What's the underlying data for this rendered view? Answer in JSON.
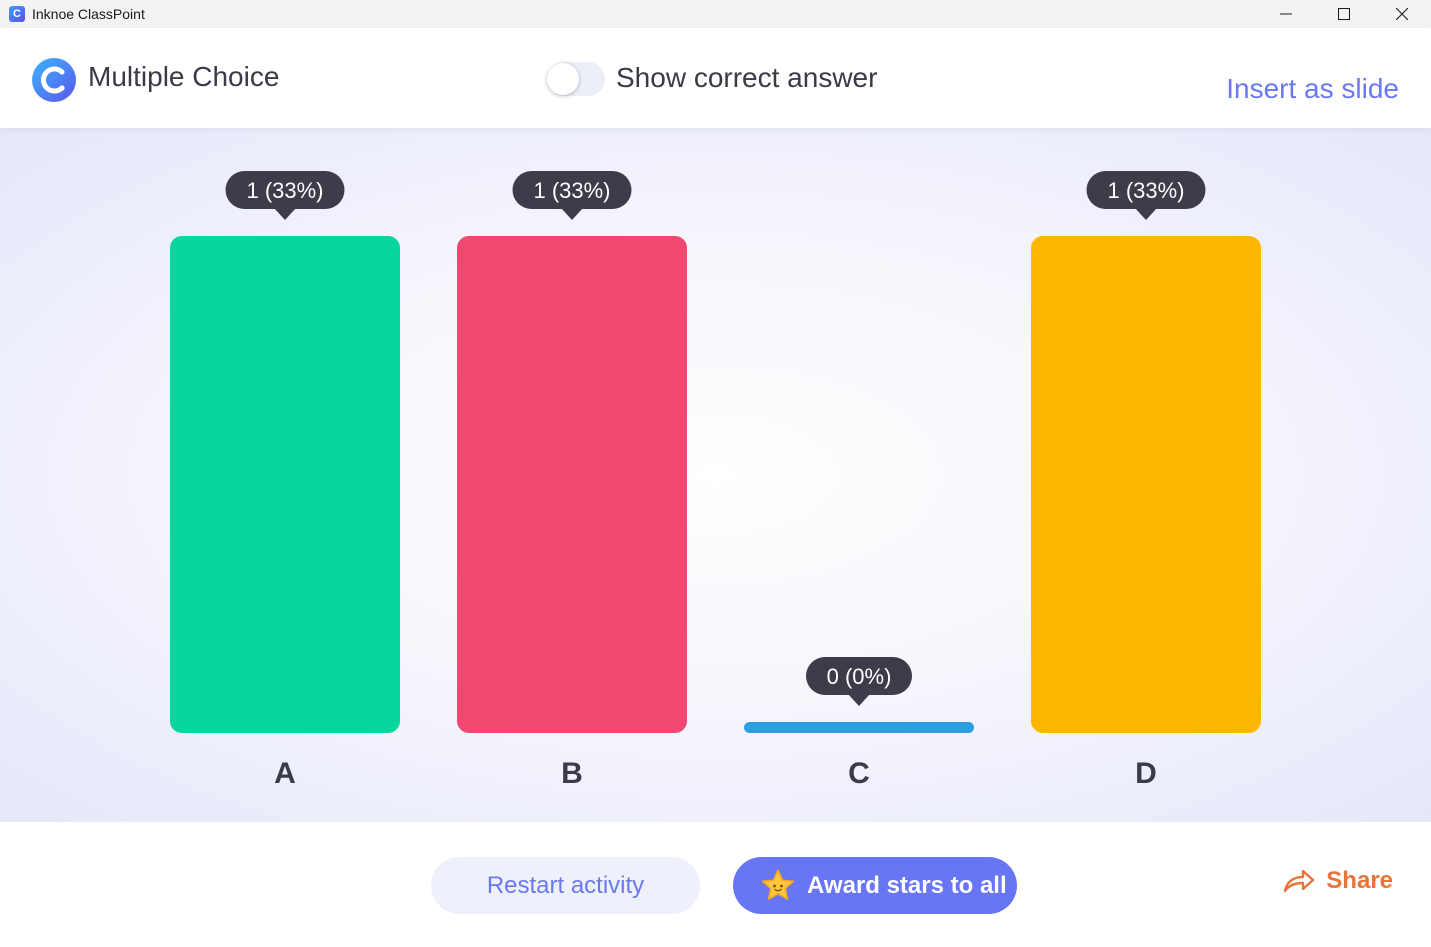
{
  "window": {
    "app_icon_letter": "C",
    "title": "Inknoe ClassPoint"
  },
  "header": {
    "title": "Multiple Choice",
    "toggle_label": "Show correct answer",
    "toggle_on": false,
    "insert_label": "Insert as slide"
  },
  "footer": {
    "restart_label": "Restart activity",
    "award_label": "Award stars to all",
    "share_label": "Share"
  },
  "colors": {
    "accent": "#6875f4",
    "link": "#6b79f0",
    "share": "#e8743a"
  },
  "chart_data": {
    "type": "bar",
    "categories": [
      "A",
      "B",
      "C",
      "D"
    ],
    "values": [
      1,
      1,
      0,
      1
    ],
    "labels": [
      "1 (33%)",
      "1 (33%)",
      "0 (0%)",
      "1 (33%)"
    ],
    "colors": [
      "#07d69d",
      "#f04870",
      "#2d9fe0",
      "#fdb700"
    ],
    "ylim": [
      0,
      1
    ],
    "grid": false,
    "legend": "none"
  }
}
